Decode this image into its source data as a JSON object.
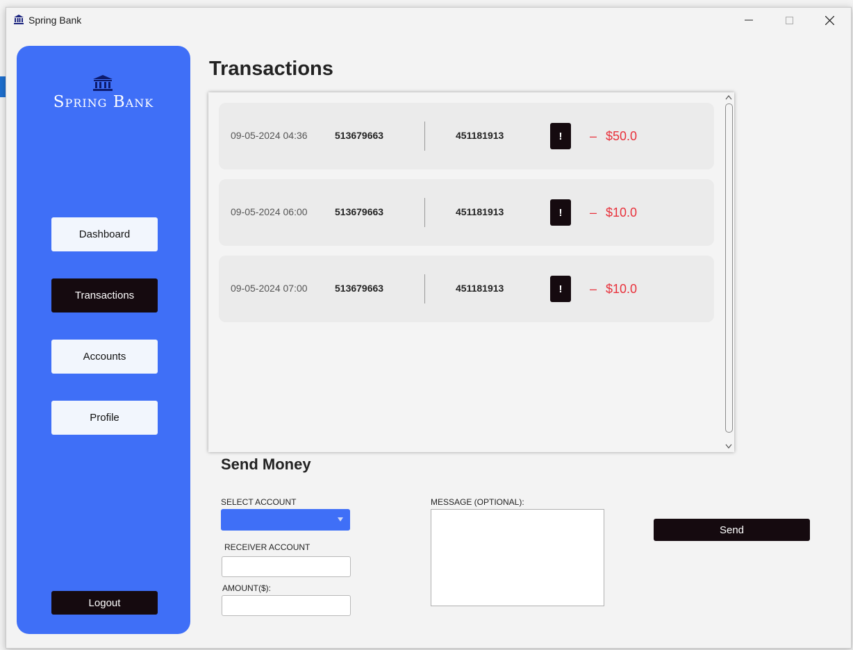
{
  "window": {
    "title": "Spring Bank"
  },
  "sidebar": {
    "logo_text": "Spring Bank",
    "nav": [
      {
        "label": "Dashboard",
        "active": false
      },
      {
        "label": "Transactions",
        "active": true
      },
      {
        "label": "Accounts",
        "active": false
      },
      {
        "label": "Profile",
        "active": false
      }
    ],
    "logout_label": "Logout"
  },
  "main": {
    "title": "Transactions",
    "transactions": [
      {
        "date": "09-05-2024 04:36",
        "from": "513679663",
        "to": "451181913",
        "alert": "!",
        "sign": "–",
        "amount": "$50.0"
      },
      {
        "date": "09-05-2024 06:00",
        "from": "513679663",
        "to": "451181913",
        "alert": "!",
        "sign": "–",
        "amount": "$10.0"
      },
      {
        "date": "09-05-2024 07:00",
        "from": "513679663",
        "to": "451181913",
        "alert": "!",
        "sign": "–",
        "amount": "$10.0"
      }
    ]
  },
  "send_money": {
    "title": "Send Money",
    "select_account_label": "SELECT ACCOUNT",
    "select_account_value": "",
    "receiver_label": "RECEIVER ACCOUNT",
    "receiver_value": "",
    "amount_label": "AMOUNT($):",
    "amount_value": "",
    "message_label": "MESSAGE (OPTIONAL):",
    "message_value": "",
    "send_label": "Send"
  },
  "colors": {
    "accent": "#3f6ff7",
    "dark": "#150a0f",
    "negative": "#e8303a"
  }
}
